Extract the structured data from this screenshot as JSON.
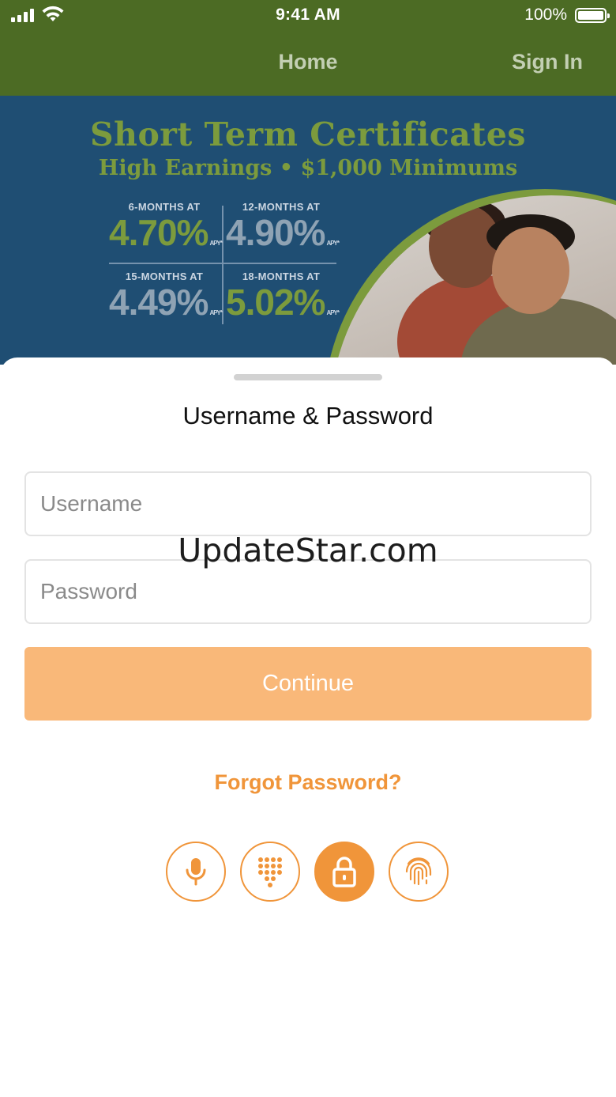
{
  "status_bar": {
    "time": "9:41 AM",
    "battery": "100%"
  },
  "nav": {
    "home_label": "Home",
    "signin_label": "Sign In"
  },
  "banner": {
    "title": "Short Term Certificates",
    "subtitle": "High Earnings • $1,000 Minimums",
    "rates": [
      {
        "term": "6-MONTHS AT",
        "rate": "4.70%",
        "apy": "APY*"
      },
      {
        "term": "12-MONTHS AT",
        "rate": "4.90%",
        "apy": "APY*"
      },
      {
        "term": "15-MONTHS AT",
        "rate": "4.49%",
        "apy": "APY*"
      },
      {
        "term": "18-MONTHS AT",
        "rate": "5.02%",
        "apy": "APY*"
      }
    ]
  },
  "login": {
    "title": "Username & Password",
    "username_placeholder": "Username",
    "password_placeholder": "Password",
    "continue_label": "Continue",
    "forgot_label": "Forgot Password?",
    "auth_methods": [
      {
        "icon": "microphone-icon",
        "active": false
      },
      {
        "icon": "keypad-icon",
        "active": false
      },
      {
        "icon": "lock-icon",
        "active": true
      },
      {
        "icon": "fingerprint-icon",
        "active": false
      }
    ]
  },
  "watermark": "UpdateStar.com",
  "colors": {
    "nav_bg": "#4c6b24",
    "banner_bg": "#1f4e73",
    "accent": "#f0953a",
    "button": "#f9b879",
    "rate_green": "#7c9b3d"
  }
}
